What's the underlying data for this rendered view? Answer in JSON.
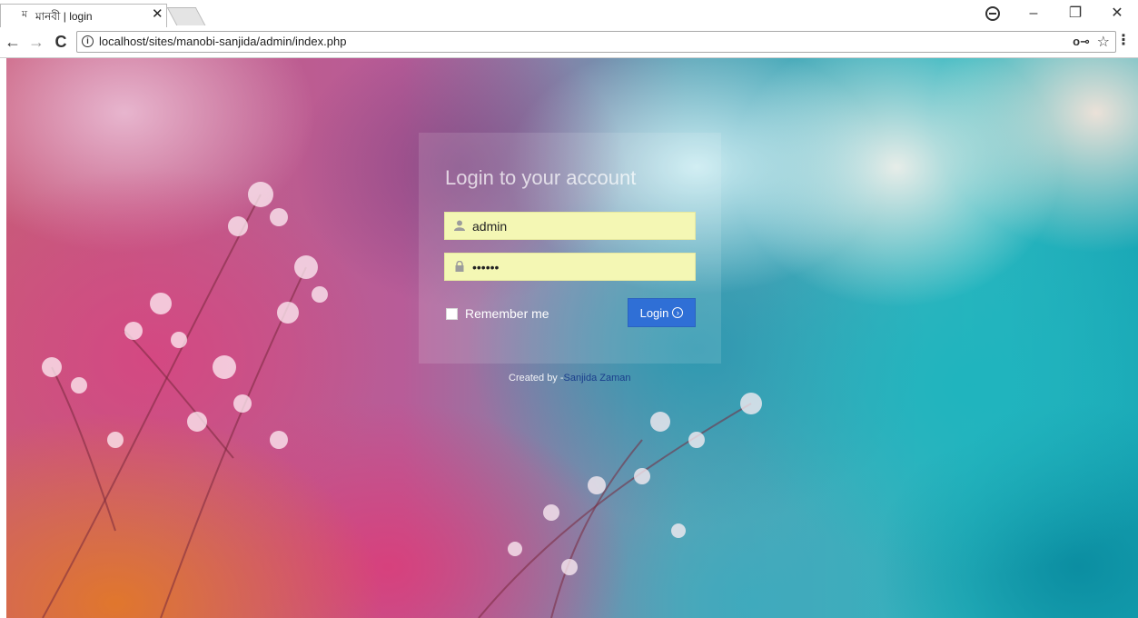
{
  "browser": {
    "tab_title": "মানবী | login",
    "tab_favicon": "ম",
    "url": "localhost/sites/manobi-sanjida/admin/index.php"
  },
  "icons": {
    "back": "arrow-left-icon",
    "forward": "arrow-right-icon",
    "reload": "reload-icon",
    "info": "info-icon",
    "key": "key-icon",
    "star": "star-icon",
    "menu": "kebab-menu-icon",
    "profile": "profile-icon",
    "minimize": "minimize-icon",
    "restore": "restore-icon",
    "close": "close-icon",
    "user": "user-icon",
    "lock": "lock-icon",
    "login_arrow": "circle-arrow-right-icon"
  },
  "login": {
    "heading": "Login to your account",
    "username_value": "admin",
    "password_value": "••••••",
    "remember_label": "Remember me",
    "login_button_label": "Login"
  },
  "footer": {
    "credit_prefix": "Created by -",
    "credit_name": "Sanjida Zaman"
  },
  "colors": {
    "input_bg": "#f4f7b4",
    "button": "#2f6fd6",
    "link": "#1a3e8c"
  }
}
